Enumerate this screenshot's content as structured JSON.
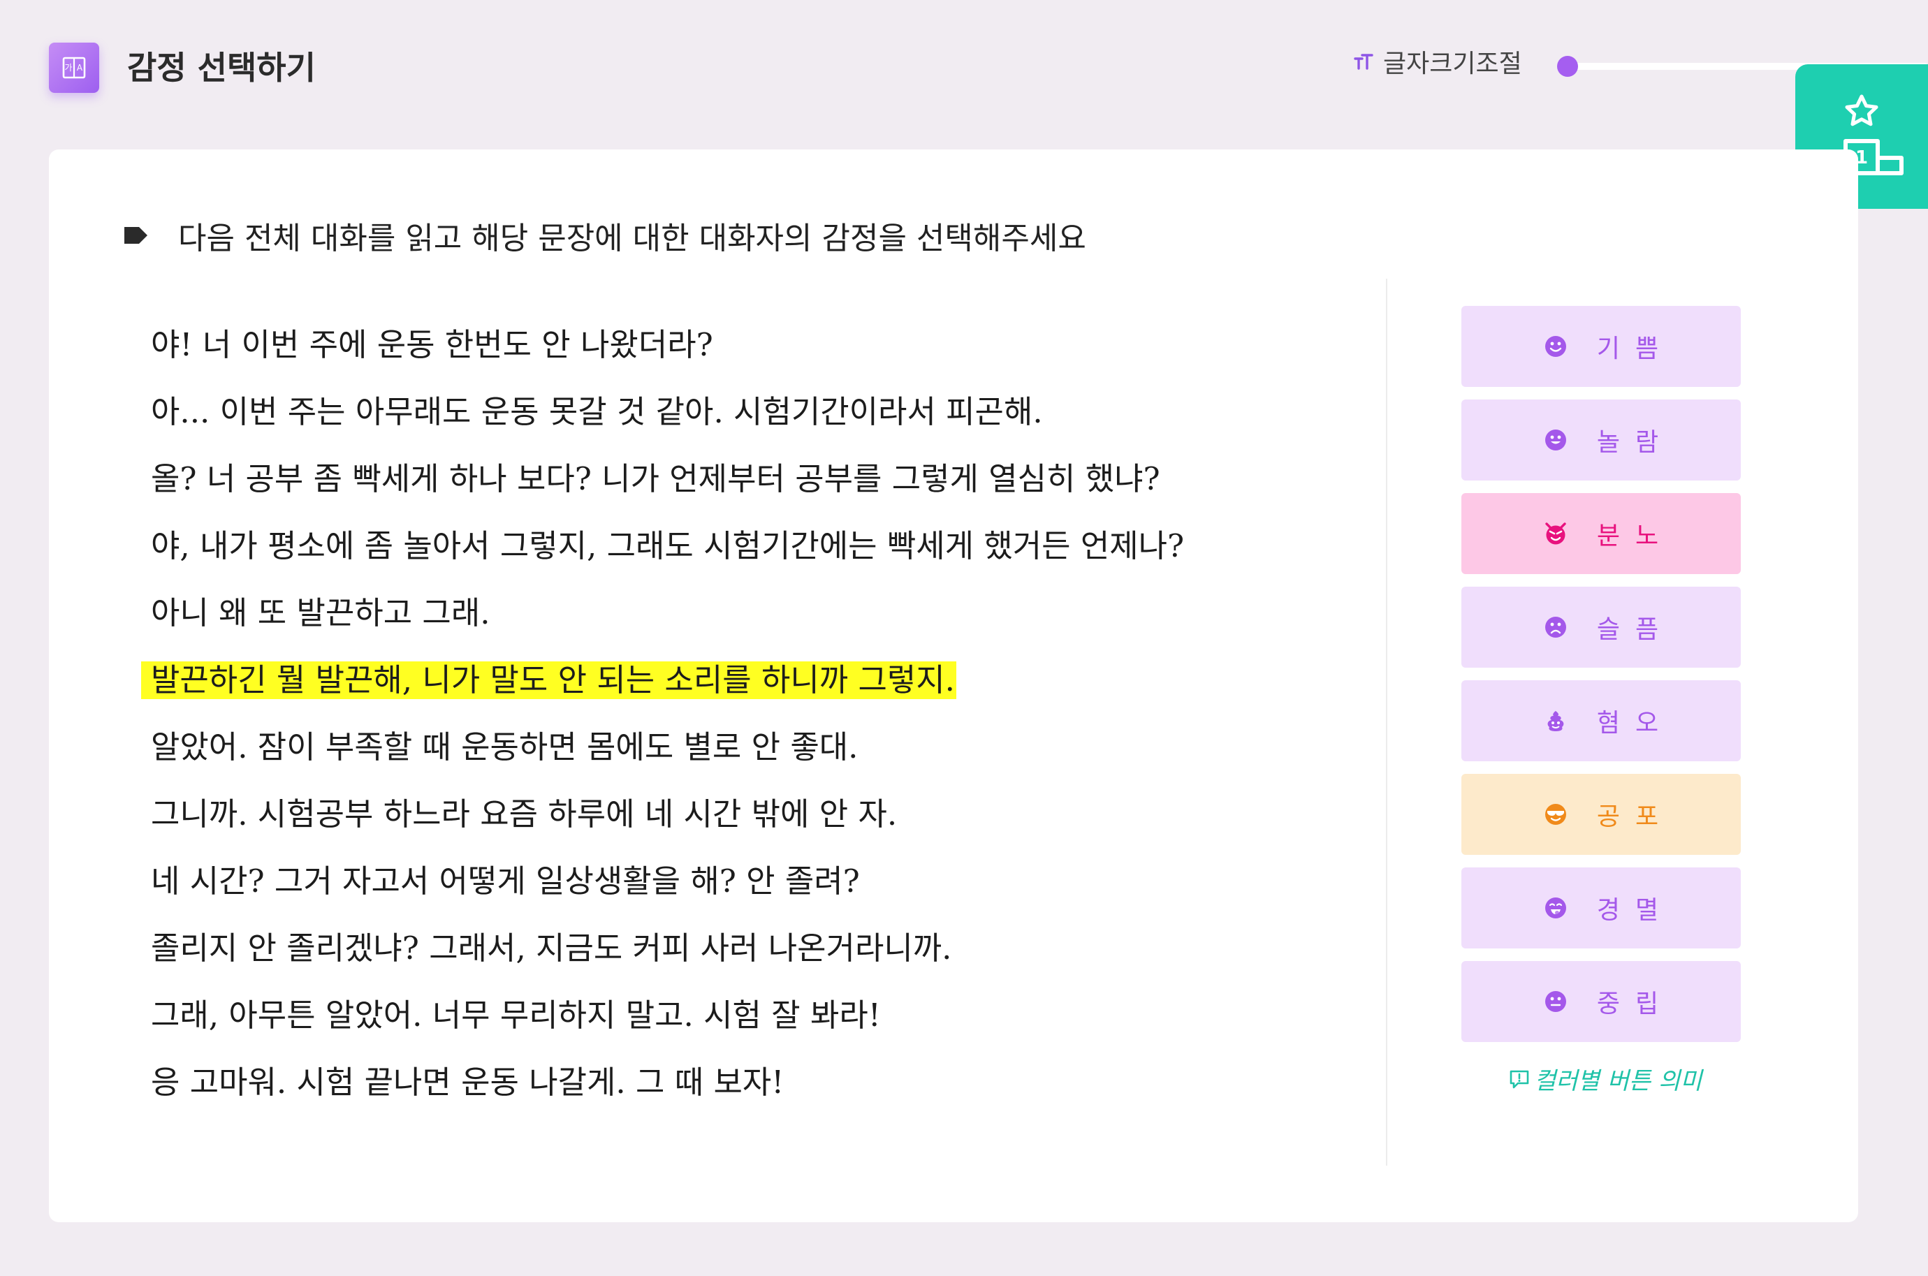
{
  "header": {
    "title": "감정 선택하기",
    "logo_icon": "book-icon",
    "font_size_label": "글자크기조절",
    "font_size_icon": "text-size-icon",
    "font_size_level": 0,
    "podium_icon": "podium-star-icon"
  },
  "instruction": {
    "icon": "tag-icon",
    "text": "다음 전체 대화를 읽고 해당 문장에 대한 대화자의 감정을 선택해주세요"
  },
  "dialogue": {
    "selected_index": 5,
    "highlight_color": "#ffff22",
    "lines": [
      "야! 너 이번 주에 운동 한번도 안 나왔더라?",
      "아... 이번 주는 아무래도 운동 못갈 것 같아. 시험기간이라서 피곤해.",
      "올? 너 공부 좀 빡세게 하나 보다? 니가 언제부터 공부를 그렇게 열심히 했냐?",
      "야, 내가 평소에 좀 놀아서 그렇지, 그래도 시험기간에는 빡세게 했거든 언제나?",
      "아니 왜 또 발끈하고 그래.",
      "발끈하긴 뭘 발끈해, 니가 말도 안 되는 소리를 하니까 그렇지.",
      "알았어. 잠이 부족할 때 운동하면 몸에도 별로 안 좋대.",
      "그니까. 시험공부 하느라 요즘 하루에 네 시간 밖에 안 자.",
      "네 시간? 그거 자고서 어떻게 일상생활을 해? 안 졸려?",
      "졸리지 안 졸리겠냐? 그래서, 지금도 커피 사러 나온거라니까.",
      "그래, 아무튼 알았어. 너무 무리하지 말고. 시험 잘 봐라!",
      "응 고마워. 시험 끝나면 운동 나갈게. 그 때 보자!"
    ]
  },
  "emotions": [
    {
      "label": "기쁨",
      "icon": "smile-face-icon",
      "bg": "#f0defc",
      "fg": "#a458ea"
    },
    {
      "label": "놀람",
      "icon": "surprised-face-icon",
      "bg": "#f0defc",
      "fg": "#a458ea"
    },
    {
      "label": "분노",
      "icon": "angry-devil-icon",
      "bg": "#fdc8e6",
      "fg": "#e8127e"
    },
    {
      "label": "슬픔",
      "icon": "sad-face-icon",
      "bg": "#f0defc",
      "fg": "#a458ea"
    },
    {
      "label": "혐오",
      "icon": "poop-icon",
      "bg": "#f0defc",
      "fg": "#a458ea"
    },
    {
      "label": "공포",
      "icon": "sunglasses-face-icon",
      "bg": "#fdeacb",
      "fg": "#f08a1a"
    },
    {
      "label": "경멸",
      "icon": "tongue-face-icon",
      "bg": "#f0defc",
      "fg": "#a458ea"
    },
    {
      "label": "중립",
      "icon": "neutral-face-icon",
      "bg": "#f0defc",
      "fg": "#a458ea"
    }
  ],
  "legend": {
    "icon": "comment-icon",
    "text": "컬러별 버튼 의미"
  }
}
